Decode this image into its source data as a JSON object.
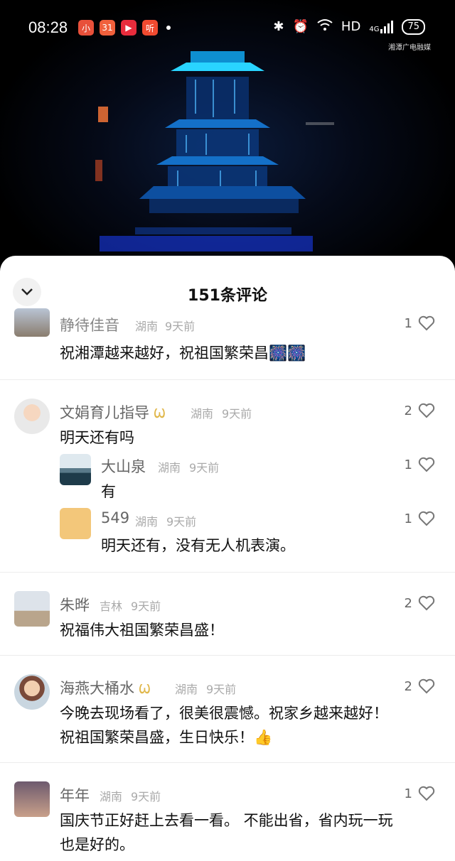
{
  "status": {
    "time": "08:28",
    "apps": [
      "小",
      "31",
      "▶",
      "听"
    ],
    "network": "HD",
    "signal": "4G",
    "battery": "75",
    "watermark": "湘潭广电融媒"
  },
  "sheet": {
    "title": "151条评论"
  },
  "comments": [
    {
      "name": "静待佳音",
      "location": "湖南",
      "time": "9天前",
      "likes": "1",
      "text": "祝湘潭越来越好，祝祖国繁荣昌🎆🎆"
    },
    {
      "name": "文娟育儿指导",
      "location": "湖南",
      "time": "9天前",
      "likes": "2",
      "text": "明天还有吗",
      "replies": [
        {
          "name": "大山泉",
          "location": "湖南",
          "time": "9天前",
          "likes": "1",
          "text": "有"
        },
        {
          "name": "549",
          "location": "湖南",
          "time": "9天前",
          "likes": "1",
          "text": "明天还有，没有无人机表演。"
        }
      ]
    },
    {
      "name": "朱晔",
      "location": "吉林",
      "time": "9天前",
      "likes": "2",
      "text": "祝福伟大祖国繁荣昌盛！"
    },
    {
      "name": "海燕大桶水",
      "location": "湖南",
      "time": "9天前",
      "likes": "2",
      "text_line1": "今晚去现场看了，很美很震憾。祝家乡越来越好！",
      "text_line2": "祝祖国繁荣昌盛，生日快乐！👍"
    },
    {
      "name": "年年",
      "location": "湖南",
      "time": "9天前",
      "likes": "1",
      "text_line1": "国庆节正好赶上去看一看。 不能出省，省内玩一玩",
      "text_line2": "也是好的。"
    }
  ],
  "colors": {
    "accent_video": "#1ec8ff",
    "vip": "#e0b74a"
  }
}
